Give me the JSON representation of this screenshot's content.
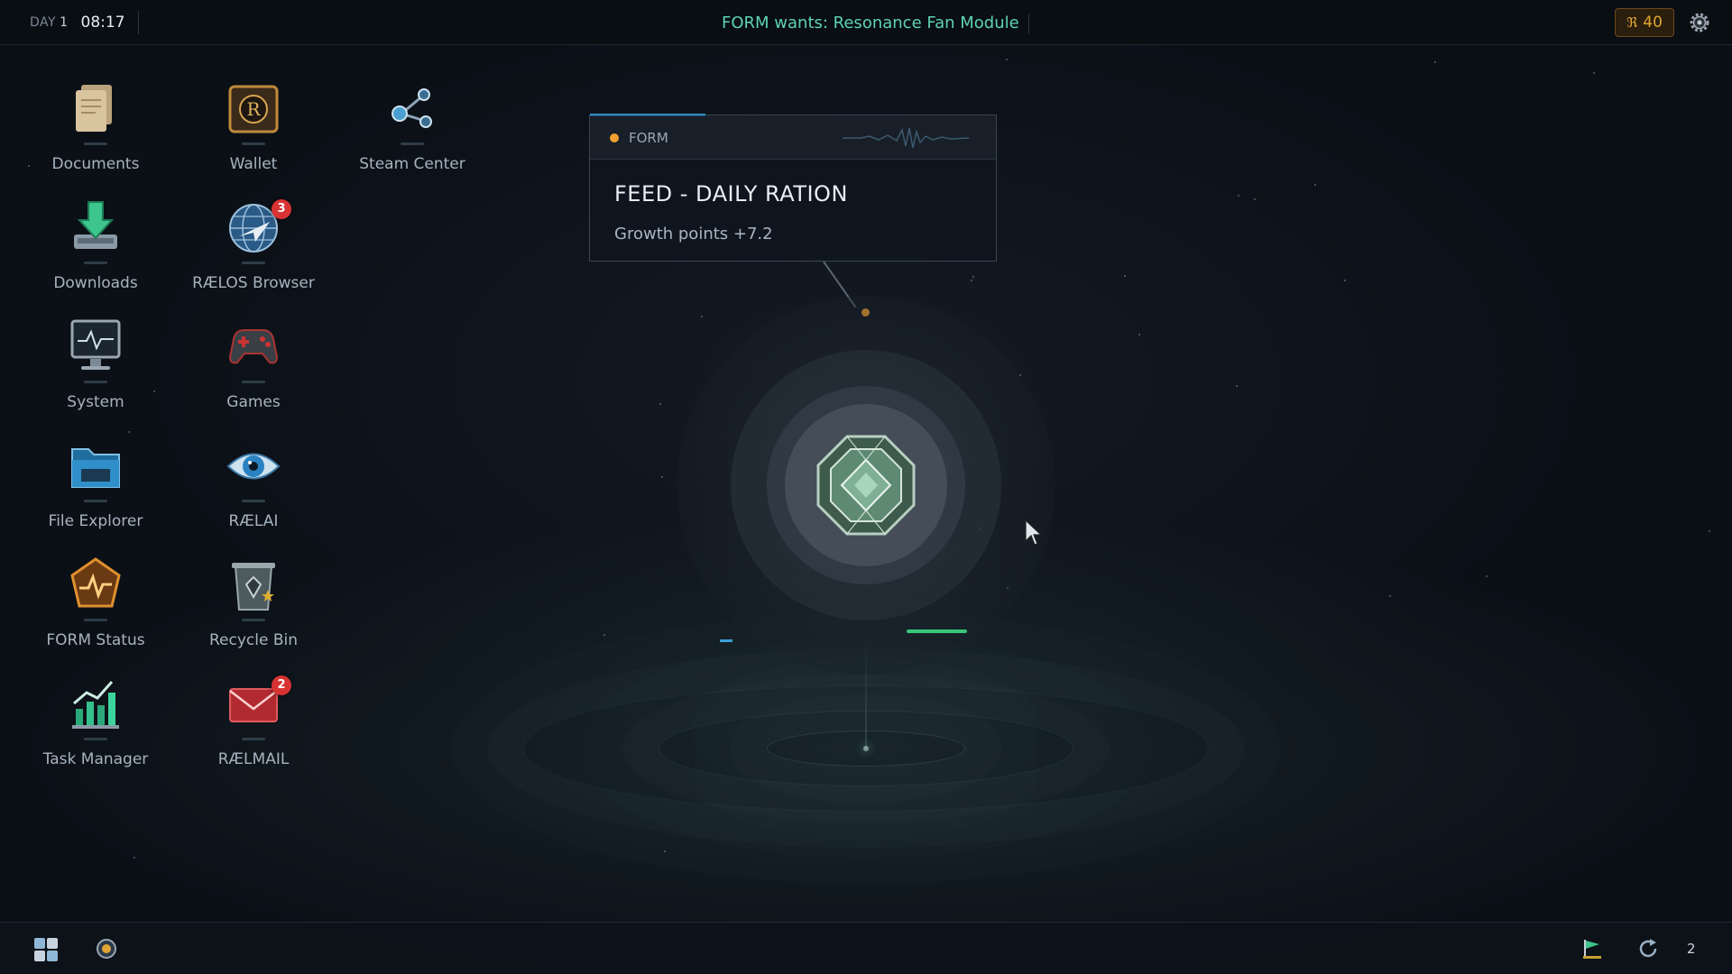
{
  "topbar": {
    "day_label": "DAY",
    "day_value": "1",
    "clock": "08:17",
    "wants_text": "FORM wants: Resonance Fan Module",
    "currency_symbol": "ℜ",
    "currency_value": "40",
    "settings_icon": "gear-icon"
  },
  "desktop_icons": [
    {
      "label": "Documents",
      "icon": "documents-icon"
    },
    {
      "label": "Wallet",
      "icon": "wallet-icon"
    },
    {
      "label": "Steam Center",
      "icon": "share-nodes-icon"
    },
    {
      "label": "Downloads",
      "icon": "download-icon"
    },
    {
      "label": "RÆLOS Browser",
      "icon": "globe-icon",
      "badge": "3"
    },
    {
      "label": "System",
      "icon": "monitor-icon"
    },
    {
      "label": "Games",
      "icon": "gamepad-icon"
    },
    {
      "label": "File Explorer",
      "icon": "folder-icon"
    },
    {
      "label": "RÆLAI",
      "icon": "eye-icon"
    },
    {
      "label": "FORM Status",
      "icon": "form-status-icon"
    },
    {
      "label": "Recycle Bin",
      "icon": "recycle-bin-icon"
    },
    {
      "label": "Task Manager",
      "icon": "chart-icon"
    },
    {
      "label": "RÆLMAIL",
      "icon": "mail-icon",
      "badge": "2"
    }
  ],
  "notification": {
    "tag": "FORM",
    "title": "FEED  - DAILY RATION",
    "subtitle": "Growth points +7.2"
  },
  "taskbar": {
    "start_icon": "grid-icon",
    "app_icon": "orb-icon",
    "flag_icon": "flag-icon",
    "refresh_icon": "refresh-icon",
    "count": "2"
  },
  "colors": {
    "accent_green": "#5ed3b3",
    "currency": "#e0a534",
    "badge": "#d93232",
    "popup_dot": "#f0a030",
    "popup_accent": "#2d8ec2"
  }
}
